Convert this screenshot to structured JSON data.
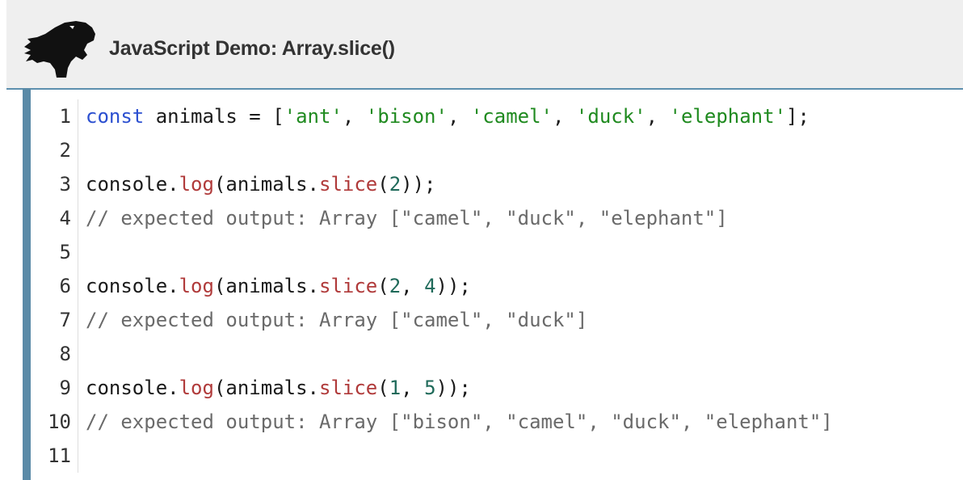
{
  "header": {
    "title": "JavaScript Demo: Array.slice()",
    "logo_icon": "dinosaur-logo-icon"
  },
  "colors": {
    "header_bg": "#efefef",
    "accent_bar": "#5a8aa7",
    "keyword": "#2b4fd0",
    "string": "#1f8a1f",
    "method": "#b03a3a",
    "number": "#1f6a5a",
    "comment": "#6a6a6a"
  },
  "editor": {
    "lines": [
      {
        "number": "1",
        "tokens": [
          {
            "type": "keyword",
            "text": "const"
          },
          {
            "type": "plain",
            "text": " animals = ["
          },
          {
            "type": "string",
            "text": "'ant'"
          },
          {
            "type": "plain",
            "text": ", "
          },
          {
            "type": "string",
            "text": "'bison'"
          },
          {
            "type": "plain",
            "text": ", "
          },
          {
            "type": "string",
            "text": "'camel'"
          },
          {
            "type": "plain",
            "text": ", "
          },
          {
            "type": "string",
            "text": "'duck'"
          },
          {
            "type": "plain",
            "text": ", "
          },
          {
            "type": "string",
            "text": "'elephant'"
          },
          {
            "type": "plain",
            "text": "];"
          }
        ]
      },
      {
        "number": "2",
        "tokens": []
      },
      {
        "number": "3",
        "tokens": [
          {
            "type": "plain",
            "text": "console."
          },
          {
            "type": "method",
            "text": "log"
          },
          {
            "type": "plain",
            "text": "(animals."
          },
          {
            "type": "method",
            "text": "slice"
          },
          {
            "type": "plain",
            "text": "("
          },
          {
            "type": "number",
            "text": "2"
          },
          {
            "type": "plain",
            "text": "));"
          }
        ]
      },
      {
        "number": "4",
        "tokens": [
          {
            "type": "comment",
            "text": "// expected output: Array [\"camel\", \"duck\", \"elephant\"]"
          }
        ]
      },
      {
        "number": "5",
        "tokens": []
      },
      {
        "number": "6",
        "tokens": [
          {
            "type": "plain",
            "text": "console."
          },
          {
            "type": "method",
            "text": "log"
          },
          {
            "type": "plain",
            "text": "(animals."
          },
          {
            "type": "method",
            "text": "slice"
          },
          {
            "type": "plain",
            "text": "("
          },
          {
            "type": "number",
            "text": "2"
          },
          {
            "type": "plain",
            "text": ", "
          },
          {
            "type": "number",
            "text": "4"
          },
          {
            "type": "plain",
            "text": "));"
          }
        ]
      },
      {
        "number": "7",
        "tokens": [
          {
            "type": "comment",
            "text": "// expected output: Array [\"camel\", \"duck\"]"
          }
        ]
      },
      {
        "number": "8",
        "tokens": []
      },
      {
        "number": "9",
        "tokens": [
          {
            "type": "plain",
            "text": "console."
          },
          {
            "type": "method",
            "text": "log"
          },
          {
            "type": "plain",
            "text": "(animals."
          },
          {
            "type": "method",
            "text": "slice"
          },
          {
            "type": "plain",
            "text": "("
          },
          {
            "type": "number",
            "text": "1"
          },
          {
            "type": "plain",
            "text": ", "
          },
          {
            "type": "number",
            "text": "5"
          },
          {
            "type": "plain",
            "text": "));"
          }
        ]
      },
      {
        "number": "10",
        "tokens": [
          {
            "type": "comment",
            "text": "// expected output: Array [\"bison\", \"camel\", \"duck\", \"elephant\"]"
          }
        ]
      },
      {
        "number": "11",
        "tokens": []
      }
    ]
  }
}
